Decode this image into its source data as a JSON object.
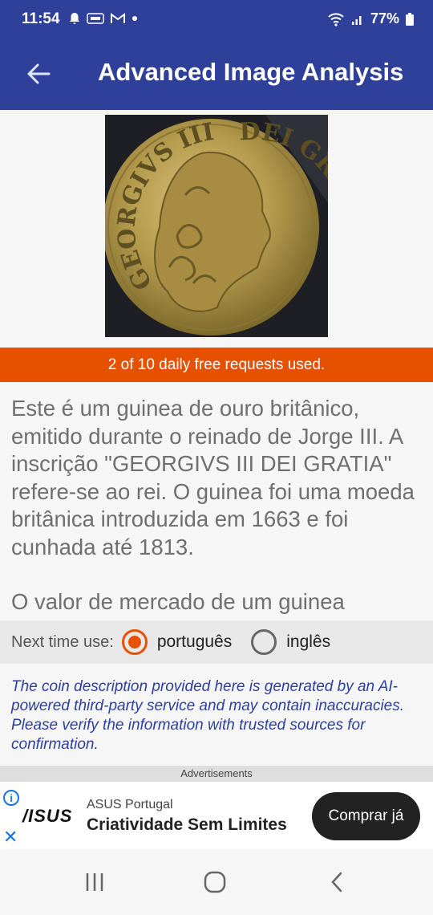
{
  "status_bar": {
    "time": "11:54",
    "notification_icons": [
      "bell-icon",
      "temu-icon",
      "gmail-icon",
      "dot-icon"
    ],
    "battery": "77%"
  },
  "app_bar": {
    "title": "Advanced Image Analysis",
    "back_icon": "arrow-left-icon"
  },
  "coin_image": {
    "legend_left": "GEORGIVS III",
    "legend_right": "DEI GRATIA"
  },
  "usage_banner": "2 of 10 daily free requests used.",
  "description": {
    "paragraph_1": "Este é um guinea de ouro britânico, emitido durante o reinado de Jorge III. A inscrição \"GEORGIVS III DEI GRATIA\" refere-se ao rei. O guinea foi uma moeda britânica introduzida em 1663 e foi cunhada até 1813.",
    "paragraph_2": "O valor de mercado de um guinea"
  },
  "language_selector": {
    "label": "Next time use:",
    "options": [
      {
        "label": "português",
        "selected": true
      },
      {
        "label": "inglês",
        "selected": false
      }
    ]
  },
  "disclaimer": "The coin description provided here is generated by an AI-powered third-party service and may contain inaccuracies. Please verify the information with trusted sources for confirmation.",
  "ads": {
    "label": "Advertisements",
    "logo": "/ISUS",
    "brand": "ASUS Portugal",
    "slogan": "Criatividade Sem Limites",
    "cta": "Comprar já",
    "info_glyph": "i",
    "close_glyph": "✕"
  },
  "colors": {
    "primary": "#2e409a",
    "accent": "#e65100",
    "disclaimer_text": "#2b3fa0"
  }
}
